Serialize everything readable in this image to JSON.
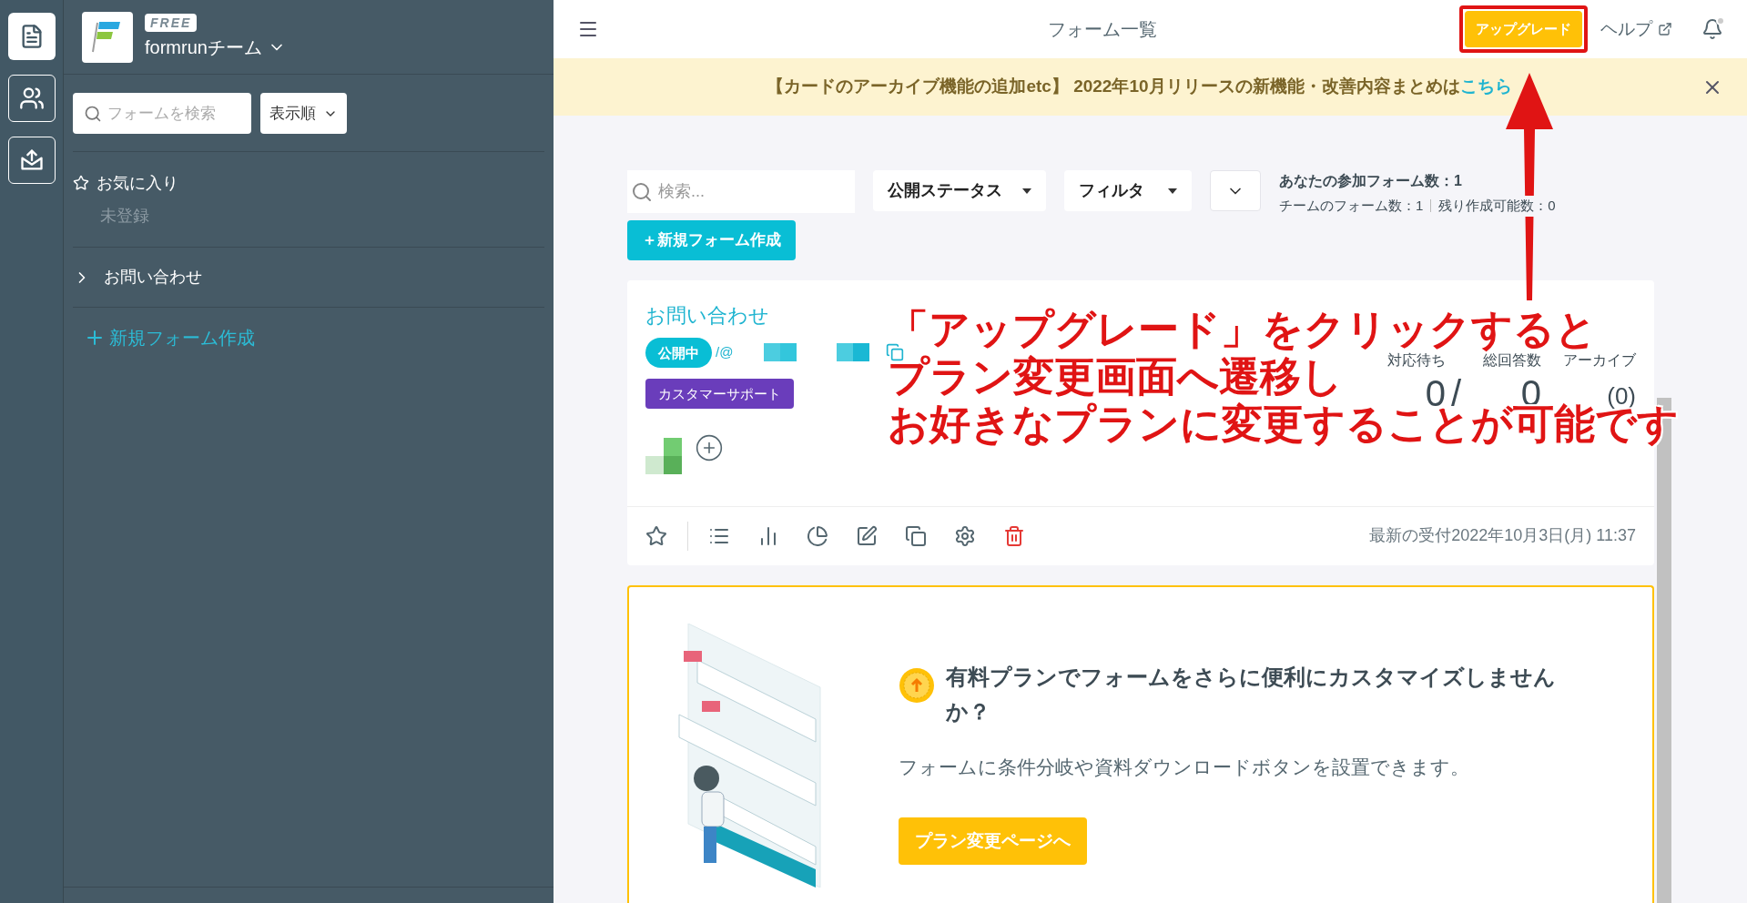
{
  "rail": [
    {
      "kind": "forms",
      "selected": true
    },
    {
      "kind": "team",
      "selected": false
    },
    {
      "kind": "export",
      "selected": false
    }
  ],
  "sidebar": {
    "plan_badge": "FREE",
    "team_name": "formrunチーム",
    "search": {
      "placeholder": "フォームを検索"
    },
    "sort_button": "表示順",
    "favorites": {
      "title": "お気に入り",
      "empty_text": "未登録"
    },
    "groups": [
      {
        "label": "お問い合わせ",
        "expanded": false
      }
    ],
    "new_form_link": "新規フォーム作成"
  },
  "header": {
    "title": "フォーム一覧",
    "upgrade_button": "アップグレード",
    "help_link": "ヘルプ",
    "has_notification": true
  },
  "banner": {
    "text": "【カードのアーカイブ機能の追加etc】 2022年10月リリースの新機能・改善内容まとめは",
    "link": "こちら"
  },
  "toolbar": {
    "search": {
      "placeholder": "検索..."
    },
    "status_filter": "公開ステータス",
    "filter": "フィルタ",
    "joined_count": "あなたの参加フォーム数：1",
    "team_count": "チームのフォーム数：1",
    "remaining_count": "残り作成可能数：0",
    "new_form_button": "＋新規フォーム作成"
  },
  "form_card": {
    "title": "お問い合わせ",
    "status": "公開中",
    "url_prefix": "/@",
    "tag": "カスタマーサポート",
    "stats": [
      {
        "label": "対応待ち",
        "value": "0"
      },
      {
        "label": "総回答数",
        "value": "0"
      },
      {
        "label": "アーカイブ",
        "value": "(0)"
      }
    ],
    "separator": "/",
    "last_received": "最新の受付2022年10月3日(月) 11:37"
  },
  "promo": {
    "title": "有料プランでフォームをさらに便利にカスタマイズしませんか？",
    "description": "フォームに条件分岐や資料ダウンロードボタンを設置できます。",
    "button": "プラン変更ページへ"
  },
  "annotation": {
    "lines": [
      "「アップグレード」をクリックすると",
      "プラン変更画面へ遷移し",
      "お好きなプランに変更することが可能です"
    ]
  }
}
